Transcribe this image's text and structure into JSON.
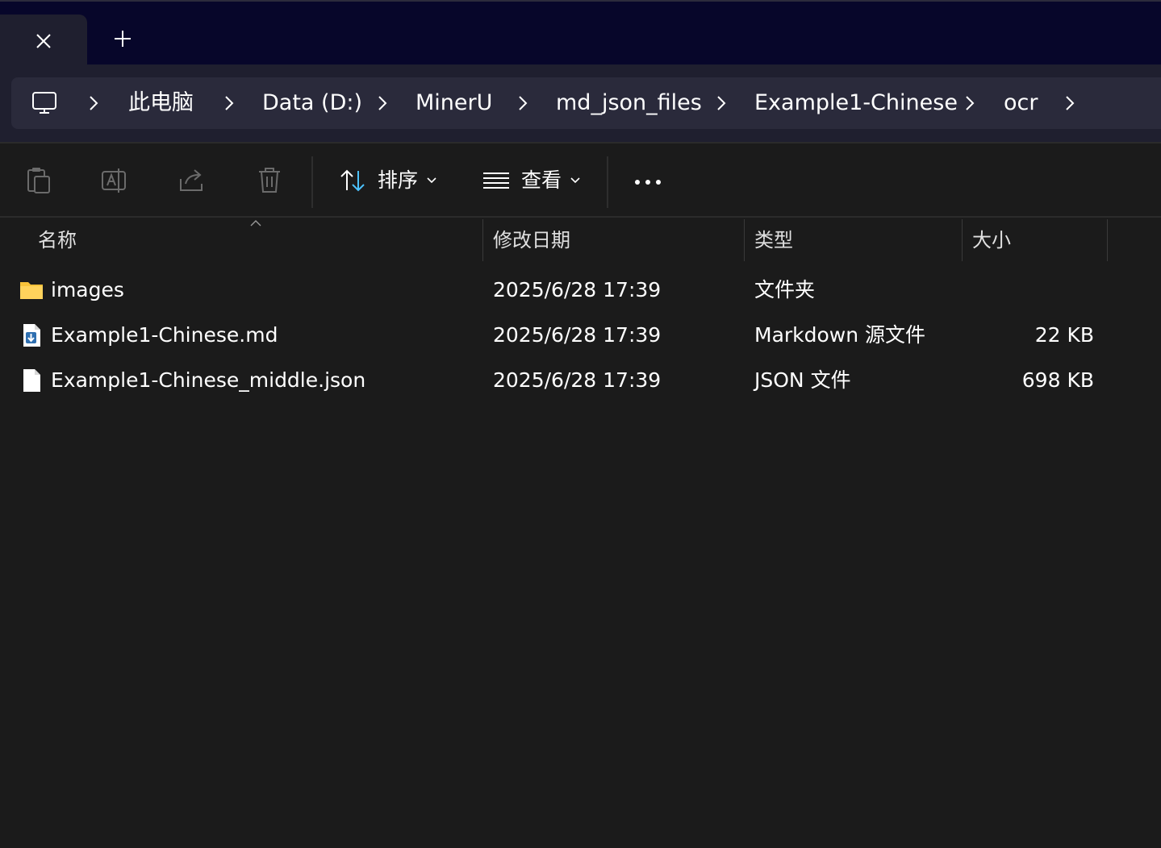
{
  "tabs": {
    "close_glyph": "✕",
    "new_glyph": "+"
  },
  "breadcrumb": {
    "items": [
      "此电脑",
      "Data (D:)",
      "MinerU",
      "md_json_files",
      "Example1-Chinese",
      "ocr"
    ]
  },
  "toolbar": {
    "sort_label": "排序",
    "view_label": "查看",
    "more_glyph": "•••"
  },
  "columns": {
    "name": "名称",
    "modified": "修改日期",
    "type": "类型",
    "size": "大小"
  },
  "files": [
    {
      "name": "images",
      "modified": "2025/6/28 17:39",
      "type": "文件夹",
      "size": "",
      "icon": "folder-icon"
    },
    {
      "name": "Example1-Chinese.md",
      "modified": "2025/6/28 17:39",
      "type": "Markdown 源文件",
      "size": "22 KB",
      "icon": "markdown-file-icon"
    },
    {
      "name": "Example1-Chinese_middle.json",
      "modified": "2025/6/28 17:39",
      "type": "JSON 文件",
      "size": "698 KB",
      "icon": "document-file-icon"
    }
  ],
  "colors": {
    "accent": "#4cc2ff",
    "folder": "#f8c23a"
  }
}
